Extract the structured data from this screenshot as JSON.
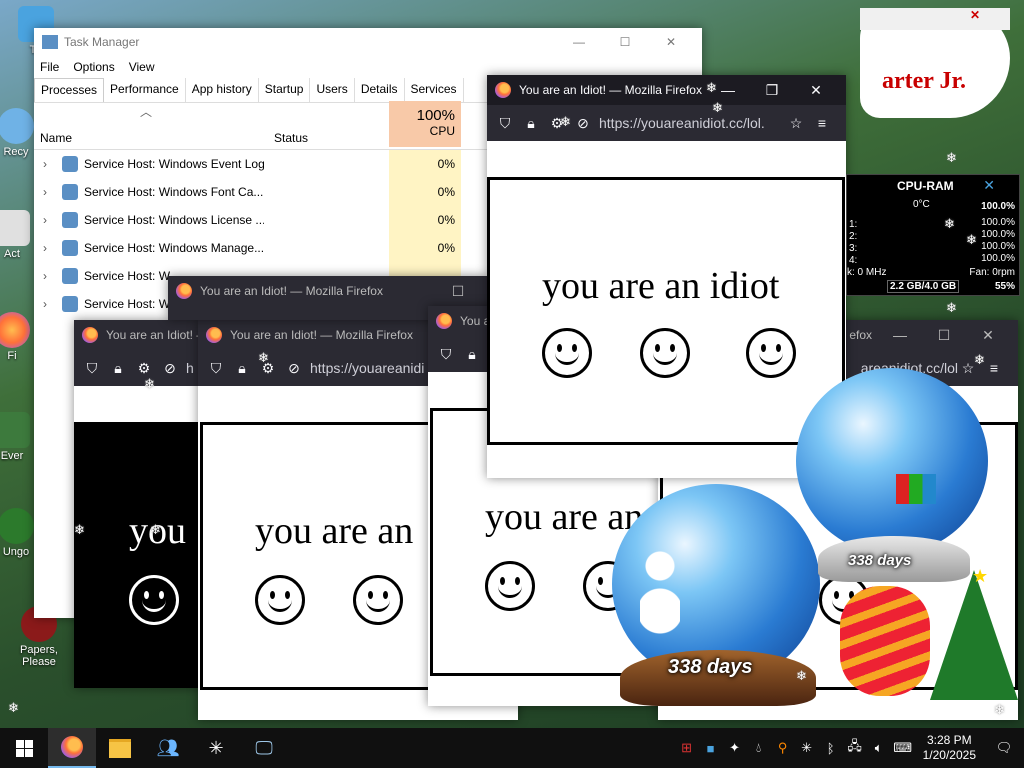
{
  "desktop": {
    "icons": [
      {
        "label": "Th"
      },
      {
        "label": "Recy"
      },
      {
        "label": "Act"
      },
      {
        "label": "Fi"
      },
      {
        "label": "Ever"
      },
      {
        "label": "Ungo"
      },
      {
        "label": "Papers, Please"
      }
    ],
    "banner_text": "arter Jr."
  },
  "task_manager": {
    "title": "Task Manager",
    "menu": [
      "File",
      "Options",
      "View"
    ],
    "tabs": [
      "Processes",
      "Performance",
      "App history",
      "Startup",
      "Users",
      "Details",
      "Services"
    ],
    "active_tab": "Processes",
    "columns": {
      "name": "Name",
      "status": "Status",
      "cpu_pct": "100%",
      "cpu": "CPU"
    },
    "rows": [
      {
        "name": "Service Host: Windows Event Log",
        "cpu": "0%"
      },
      {
        "name": "Service Host: Windows Font Ca...",
        "cpu": "0%"
      },
      {
        "name": "Service Host: Windows License ...",
        "cpu": "0%"
      },
      {
        "name": "Service Host: Windows Manage...",
        "cpu": "0%"
      },
      {
        "name": "Service Host: W",
        "cpu": ""
      },
      {
        "name": "Service Host: W",
        "cpu": ""
      }
    ]
  },
  "firefox": {
    "title": "You are an Idiot! — Mozilla Firefox",
    "title_short": "You a",
    "url": "https://youareanidiot.cc/lol.",
    "url_b": "https://youareanidi",
    "url_c": "areanidiot.cc/lol",
    "url_d": "h",
    "page_text": "you are an idiot",
    "page_text_b": "you are an",
    "page_text_c": "you are an",
    "page_text_d": "you"
  },
  "gadget": {
    "title": "CPU-RAM",
    "temp": "0°C",
    "total": "100.0%",
    "cores": [
      "100.0%",
      "100.0%",
      "100.0%",
      "100.0%",
      "100.0%"
    ],
    "core_labels": [
      "1:",
      "2:",
      "3:",
      "4:"
    ],
    "freq": "k: 0 MHz",
    "fan": "Fan: 0rpm",
    "ram": "2.2 GB/4.0 GB",
    "ram_pct": "55%"
  },
  "globes": {
    "days_label": "338 days",
    "days_label_small": "338 days"
  },
  "taskbar": {
    "time": "3:28 PM",
    "date": "1/20/2025"
  },
  "colors": {
    "taskbar": "#101010",
    "firefox_title": "#1c1b22",
    "cpu_highlight": "#fff4c4"
  }
}
